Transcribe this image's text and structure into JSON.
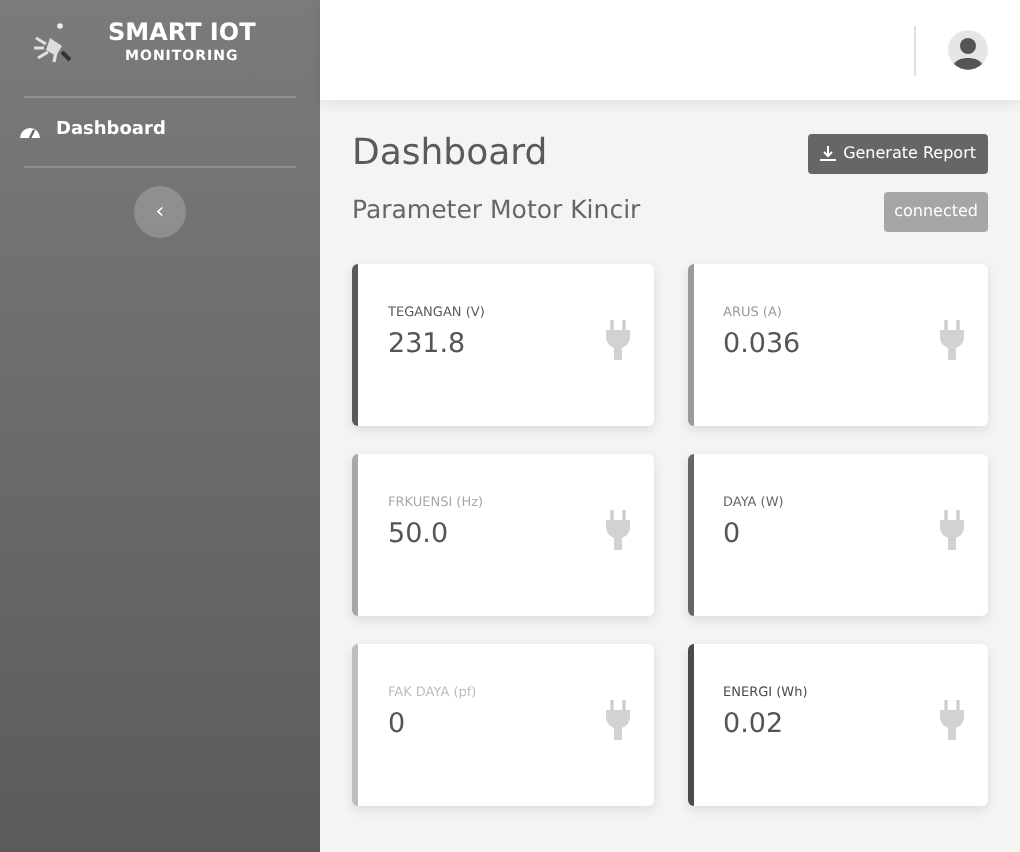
{
  "sidebar": {
    "brand": {
      "title": "SMART IOT",
      "subtitle": "MONITORING"
    },
    "items": [
      {
        "label": "Dashboard",
        "selected": true
      }
    ],
    "toggle": {
      "label": "‹"
    }
  },
  "page": {
    "title": "Dashboard",
    "action": "Generate Report",
    "section": "Parameter Motor Kincir",
    "status": "connected"
  },
  "cards": [
    {
      "label": "TEGANGAN (V)",
      "value": "231.8",
      "color": "#5a5a5a"
    },
    {
      "label": "ARUS (A)",
      "value": "0.036",
      "color": "#9a9a9a"
    },
    {
      "label": "FRKUENSI (Hz)",
      "value": "50.0",
      "color": "#a8a8a8"
    },
    {
      "label": "DAYA (W)",
      "value": "0",
      "color": "#666666"
    },
    {
      "label": "FAK DAYA (pf)",
      "value": "0",
      "color": "#bdbdbd"
    },
    {
      "label": "ENERGI (Wh)",
      "value": "0.02",
      "color": "#4a4a4a"
    }
  ]
}
